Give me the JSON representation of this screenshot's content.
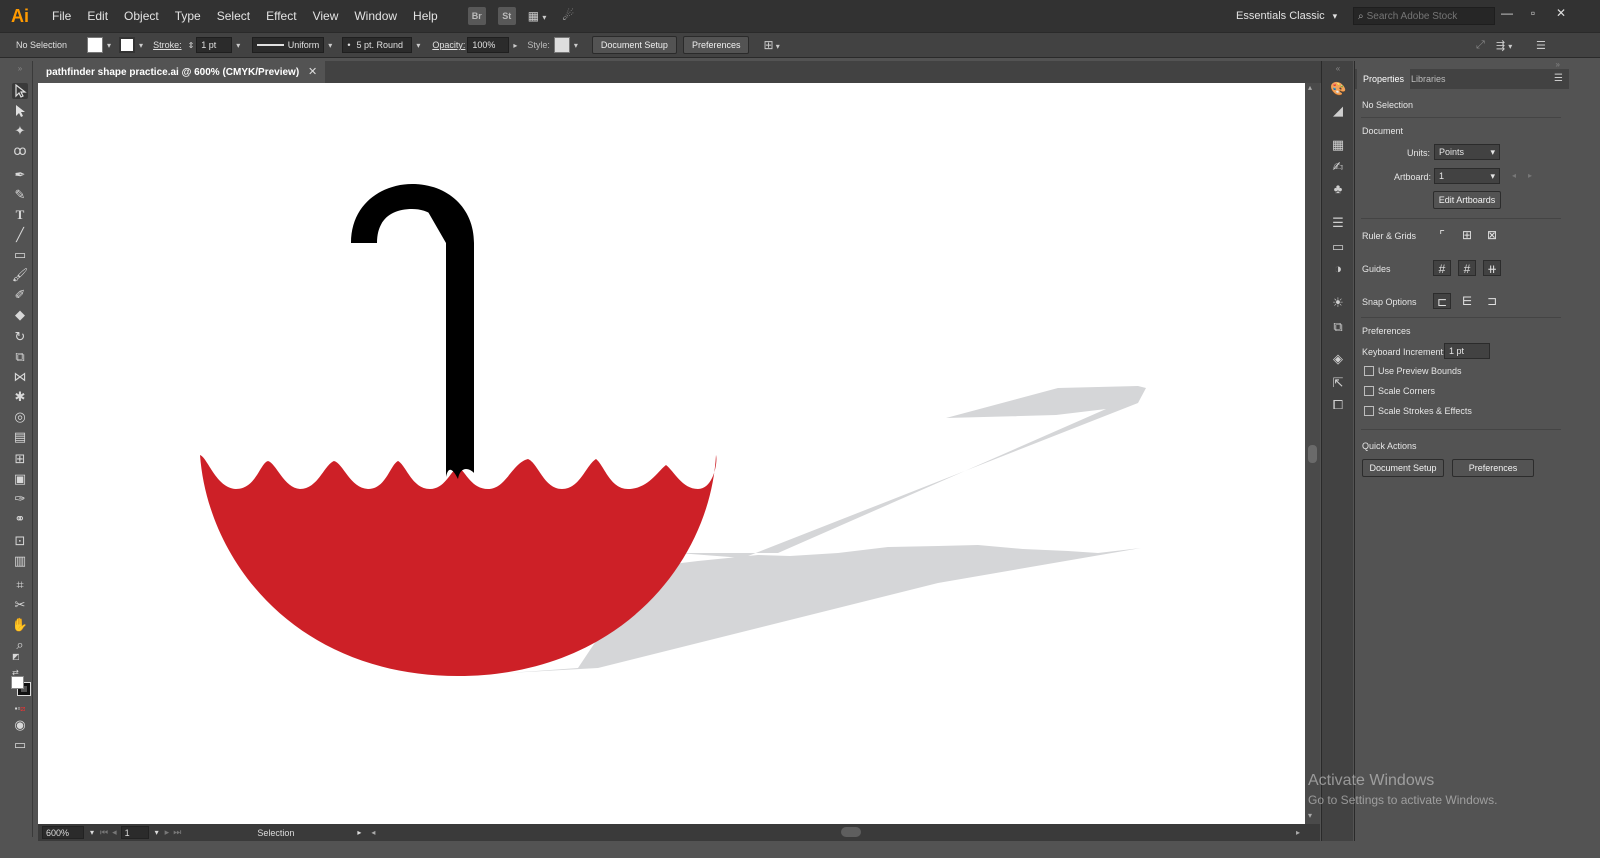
{
  "menubar": {
    "logo": "Ai",
    "items": [
      "File",
      "Edit",
      "Object",
      "Type",
      "Select",
      "Effect",
      "View",
      "Window",
      "Help"
    ],
    "bridge": "Br",
    "stock": "St",
    "workspace": "Essentials Classic",
    "search_placeholder": "Search Adobe Stock"
  },
  "controlbar": {
    "selection": "No Selection",
    "stroke_label": "Stroke:",
    "stroke_weight": "1 pt",
    "profile": "Uniform",
    "brush": "5 pt. Round",
    "opacity_label": "Opacity:",
    "opacity": "100%",
    "style_label": "Style:",
    "document_setup": "Document Setup",
    "preferences": "Preferences"
  },
  "document": {
    "tab_title": "pathfinder shape practice.ai @ 600% (CMYK/Preview)"
  },
  "statusbar": {
    "zoom": "600%",
    "artboard": "1",
    "tool": "Selection"
  },
  "properties": {
    "tab_properties": "Properties",
    "tab_libraries": "Libraries",
    "selection": "No Selection",
    "document_header": "Document",
    "units_label": "Units:",
    "units_value": "Points",
    "artboard_label": "Artboard:",
    "artboard_value": "1",
    "edit_artboards": "Edit Artboards",
    "ruler_grids": "Ruler & Grids",
    "guides": "Guides",
    "snap_options": "Snap Options",
    "preferences_header": "Preferences",
    "keyboard_increment_label": "Keyboard Increment:",
    "keyboard_increment_value": "1 pt",
    "use_preview_bounds": "Use Preview Bounds",
    "scale_corners": "Scale Corners",
    "scale_strokes": "Scale Strokes & Effects",
    "quick_actions": "Quick Actions",
    "document_setup": "Document Setup",
    "preferences": "Preferences"
  },
  "artwork": {
    "canopy_color": "#cd2027",
    "handle_color": "#000000",
    "shadow_color": "#d5d6d8"
  },
  "watermark": {
    "title": "Activate Windows",
    "subtitle": "Go to Settings to activate Windows."
  }
}
